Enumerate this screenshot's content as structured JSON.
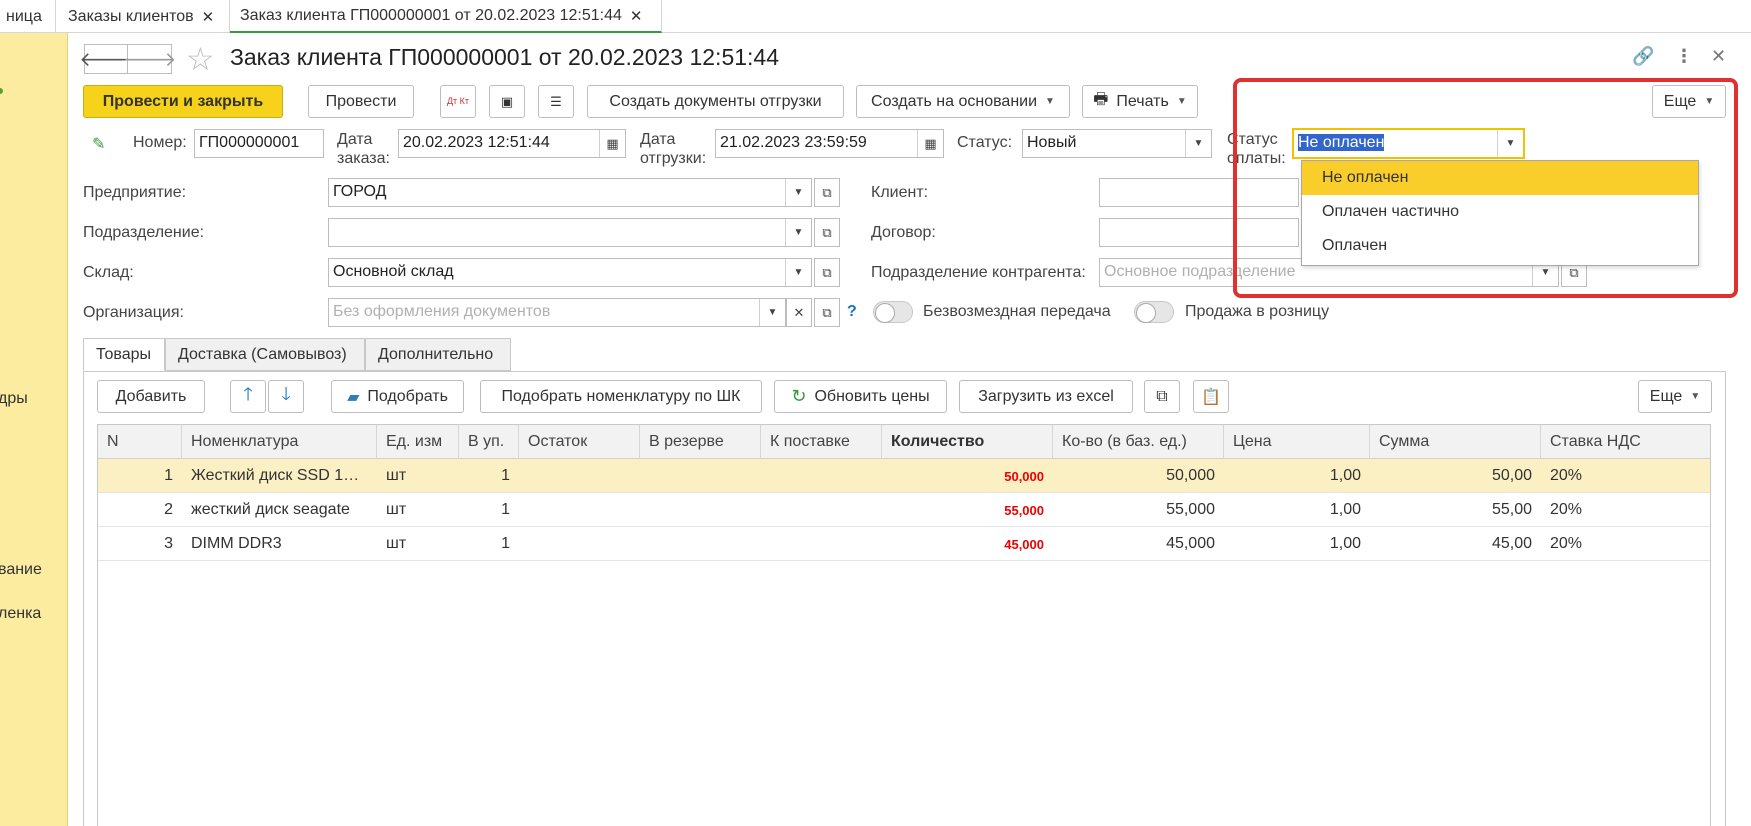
{
  "tabs": [
    {
      "label": "ница",
      "closable": false
    },
    {
      "label": "Заказы клиентов",
      "closable": true
    },
    {
      "label": "Заказ клиента ГП000000001 от 20.02.2023 12:51:44",
      "closable": true
    }
  ],
  "sidebar": {
    "items": [
      "дры",
      "вание",
      "ленка"
    ]
  },
  "header": {
    "title": "Заказ клиента ГП000000001 от 20.02.2023 12:51:44"
  },
  "toolbar": {
    "post_close": "Провести и закрыть",
    "post": "Провести",
    "dt_kt": "Дт Кт",
    "create_shipping": "Создать документы отгрузки",
    "create_based": "Создать на основании",
    "print": "Печать",
    "more": "Еще"
  },
  "form": {
    "number_label": "Номер:",
    "number": "ГП000000001",
    "order_date_label_1": "Дата",
    "order_date_label_2": "заказа:",
    "order_date": "20.02.2023 12:51:44",
    "ship_date_label_1": "Дата",
    "ship_date_label_2": "отгрузки:",
    "ship_date": "21.02.2023 23:59:59",
    "status_label": "Статус:",
    "status": "Новый",
    "pay_status_label_1": "Статус",
    "pay_status_label_2": "оплаты:",
    "pay_status": "Не оплачен",
    "enterprise_label": "Предприятие:",
    "enterprise": "ГОРОД",
    "division_label": "Подразделение:",
    "division": "",
    "warehouse_label": "Склад:",
    "warehouse": "Основной склад",
    "organization_label": "Организация:",
    "organization_placeholder": "Без оформления документов",
    "help": "?",
    "client_label": "Клиент:",
    "client": "",
    "contract_label": "Договор:",
    "contract": "",
    "counterparty_division_label": "Подразделение контрагента:",
    "counterparty_division_placeholder": "Основное подразделение",
    "free_transfer_label": "Безвозмездная передача",
    "retail_label": "Продажа в розницу"
  },
  "pay_status_options": [
    "Не оплачен",
    "Оплачен частично",
    "Оплачен"
  ],
  "page_tabs": [
    "Товары",
    "Доставка (Самовывоз)",
    "Дополнительно"
  ],
  "items_toolbar": {
    "add": "Добавить",
    "pick": "Подобрать",
    "pick_barcode": "Подобрать номенклатуру по ШК",
    "refresh_prices": "Обновить цены",
    "load_excel": "Загрузить из excel",
    "more": "Еще"
  },
  "table": {
    "columns": [
      "N",
      "Номенклатура",
      "Ед. изм",
      "В уп.",
      "Остаток",
      "В резерве",
      "К поставке",
      "Количество",
      "Ко-во (в баз. ед.)",
      "Цена",
      "Сумма",
      "Ставка НДС"
    ],
    "rows": [
      [
        "1",
        "Жесткий диск SSD 1…",
        "шт",
        "1",
        "",
        "",
        "",
        "50,000",
        "50,000",
        "1,00",
        "50,00",
        "20%"
      ],
      [
        "2",
        "жесткий диск seagate",
        "шт",
        "1",
        "",
        "",
        "",
        "55,000",
        "55,000",
        "1,00",
        "55,00",
        "20%"
      ],
      [
        "3",
        "DIMM DDR3",
        "шт",
        "1",
        "",
        "",
        "",
        "45,000",
        "45,000",
        "1,00",
        "45,00",
        "20%"
      ]
    ]
  },
  "colors": {
    "primary_button": "#f6d21a",
    "sidebar": "#fbeca0",
    "highlight_border": "#e03030",
    "selected_row": "#fbf0c4",
    "quantity_text": "#e00000"
  }
}
